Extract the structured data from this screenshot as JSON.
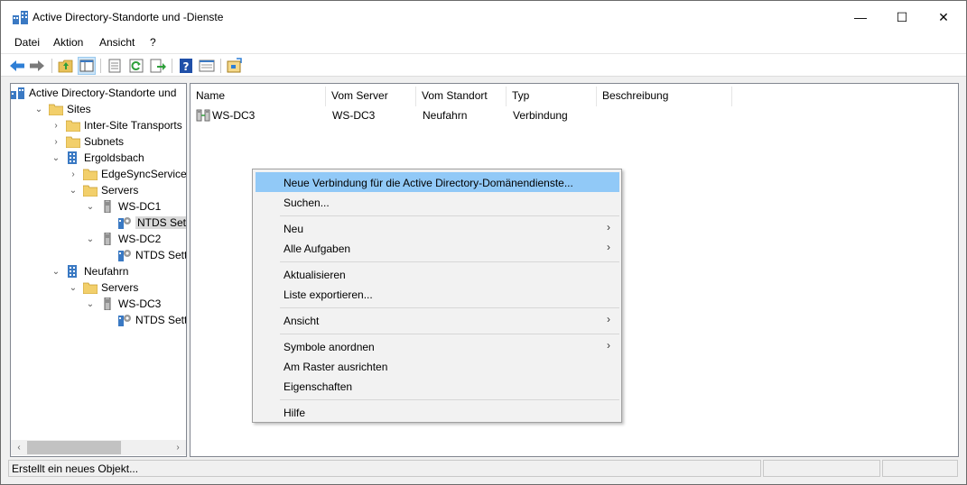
{
  "window": {
    "title": "Active Directory-Standorte und -Dienste",
    "controls": {
      "minimize": "—",
      "maximize": "☐",
      "close": "✕"
    }
  },
  "menubar": [
    "Datei",
    "Aktion",
    "Ansicht",
    "?"
  ],
  "tree": {
    "items": [
      {
        "label": "Active Directory-Standorte und",
        "icon": "ad-sites-icon",
        "arrow": ""
      },
      {
        "label": "Sites",
        "icon": "folder-icon",
        "arrow": "⌄"
      },
      {
        "label": "Inter-Site Transports",
        "icon": "folder-icon",
        "arrow": "›"
      },
      {
        "label": "Subnets",
        "icon": "folder-icon",
        "arrow": "›"
      },
      {
        "label": "Ergoldsbach",
        "icon": "site-icon",
        "arrow": "⌄"
      },
      {
        "label": "EdgeSyncService",
        "icon": "folder-icon",
        "arrow": "›"
      },
      {
        "label": "Servers",
        "icon": "folder-icon",
        "arrow": "⌄"
      },
      {
        "label": "WS-DC1",
        "icon": "server-icon",
        "arrow": "⌄"
      },
      {
        "label": "NTDS Settings",
        "icon": "ntds-settings-icon",
        "arrow": ""
      },
      {
        "label": "WS-DC2",
        "icon": "server-icon",
        "arrow": "⌄"
      },
      {
        "label": "NTDS Settings",
        "icon": "ntds-settings-icon",
        "arrow": ""
      },
      {
        "label": "Neufahrn",
        "icon": "site-icon",
        "arrow": "⌄"
      },
      {
        "label": "Servers",
        "icon": "folder-icon",
        "arrow": "⌄"
      },
      {
        "label": "WS-DC3",
        "icon": "server-icon",
        "arrow": "⌄"
      },
      {
        "label": "NTDS Settings",
        "icon": "ntds-settings-icon",
        "arrow": ""
      }
    ],
    "scroll_left": "‹",
    "scroll_right": "›"
  },
  "list": {
    "columns": [
      "Name",
      "Vom Server",
      "Vom Standort",
      "Typ",
      "Beschreibung"
    ],
    "rows": [
      {
        "name": "WS-DC3",
        "from_server": "WS-DC3",
        "from_site": "Neufahrn",
        "type": "Verbindung",
        "description": ""
      }
    ]
  },
  "context_menu": {
    "new_connection": "Neue Verbindung für die Active Directory-Domänendienste...",
    "find": "Suchen...",
    "new": "Neu",
    "all_tasks": "Alle Aufgaben",
    "refresh": "Aktualisieren",
    "export_list": "Liste exportieren...",
    "view": "Ansicht",
    "arrange_icons": "Symbole anordnen",
    "align_to_grid": "Am Raster ausrichten",
    "properties": "Eigenschaften",
    "help": "Hilfe",
    "submenu_arrow": "›"
  },
  "status": {
    "text": "Erstellt ein neues Objekt..."
  },
  "colors": {
    "menu_highlight": "#91c9f7",
    "selection": "#d9d9d9",
    "accent": "#1e73d2"
  }
}
